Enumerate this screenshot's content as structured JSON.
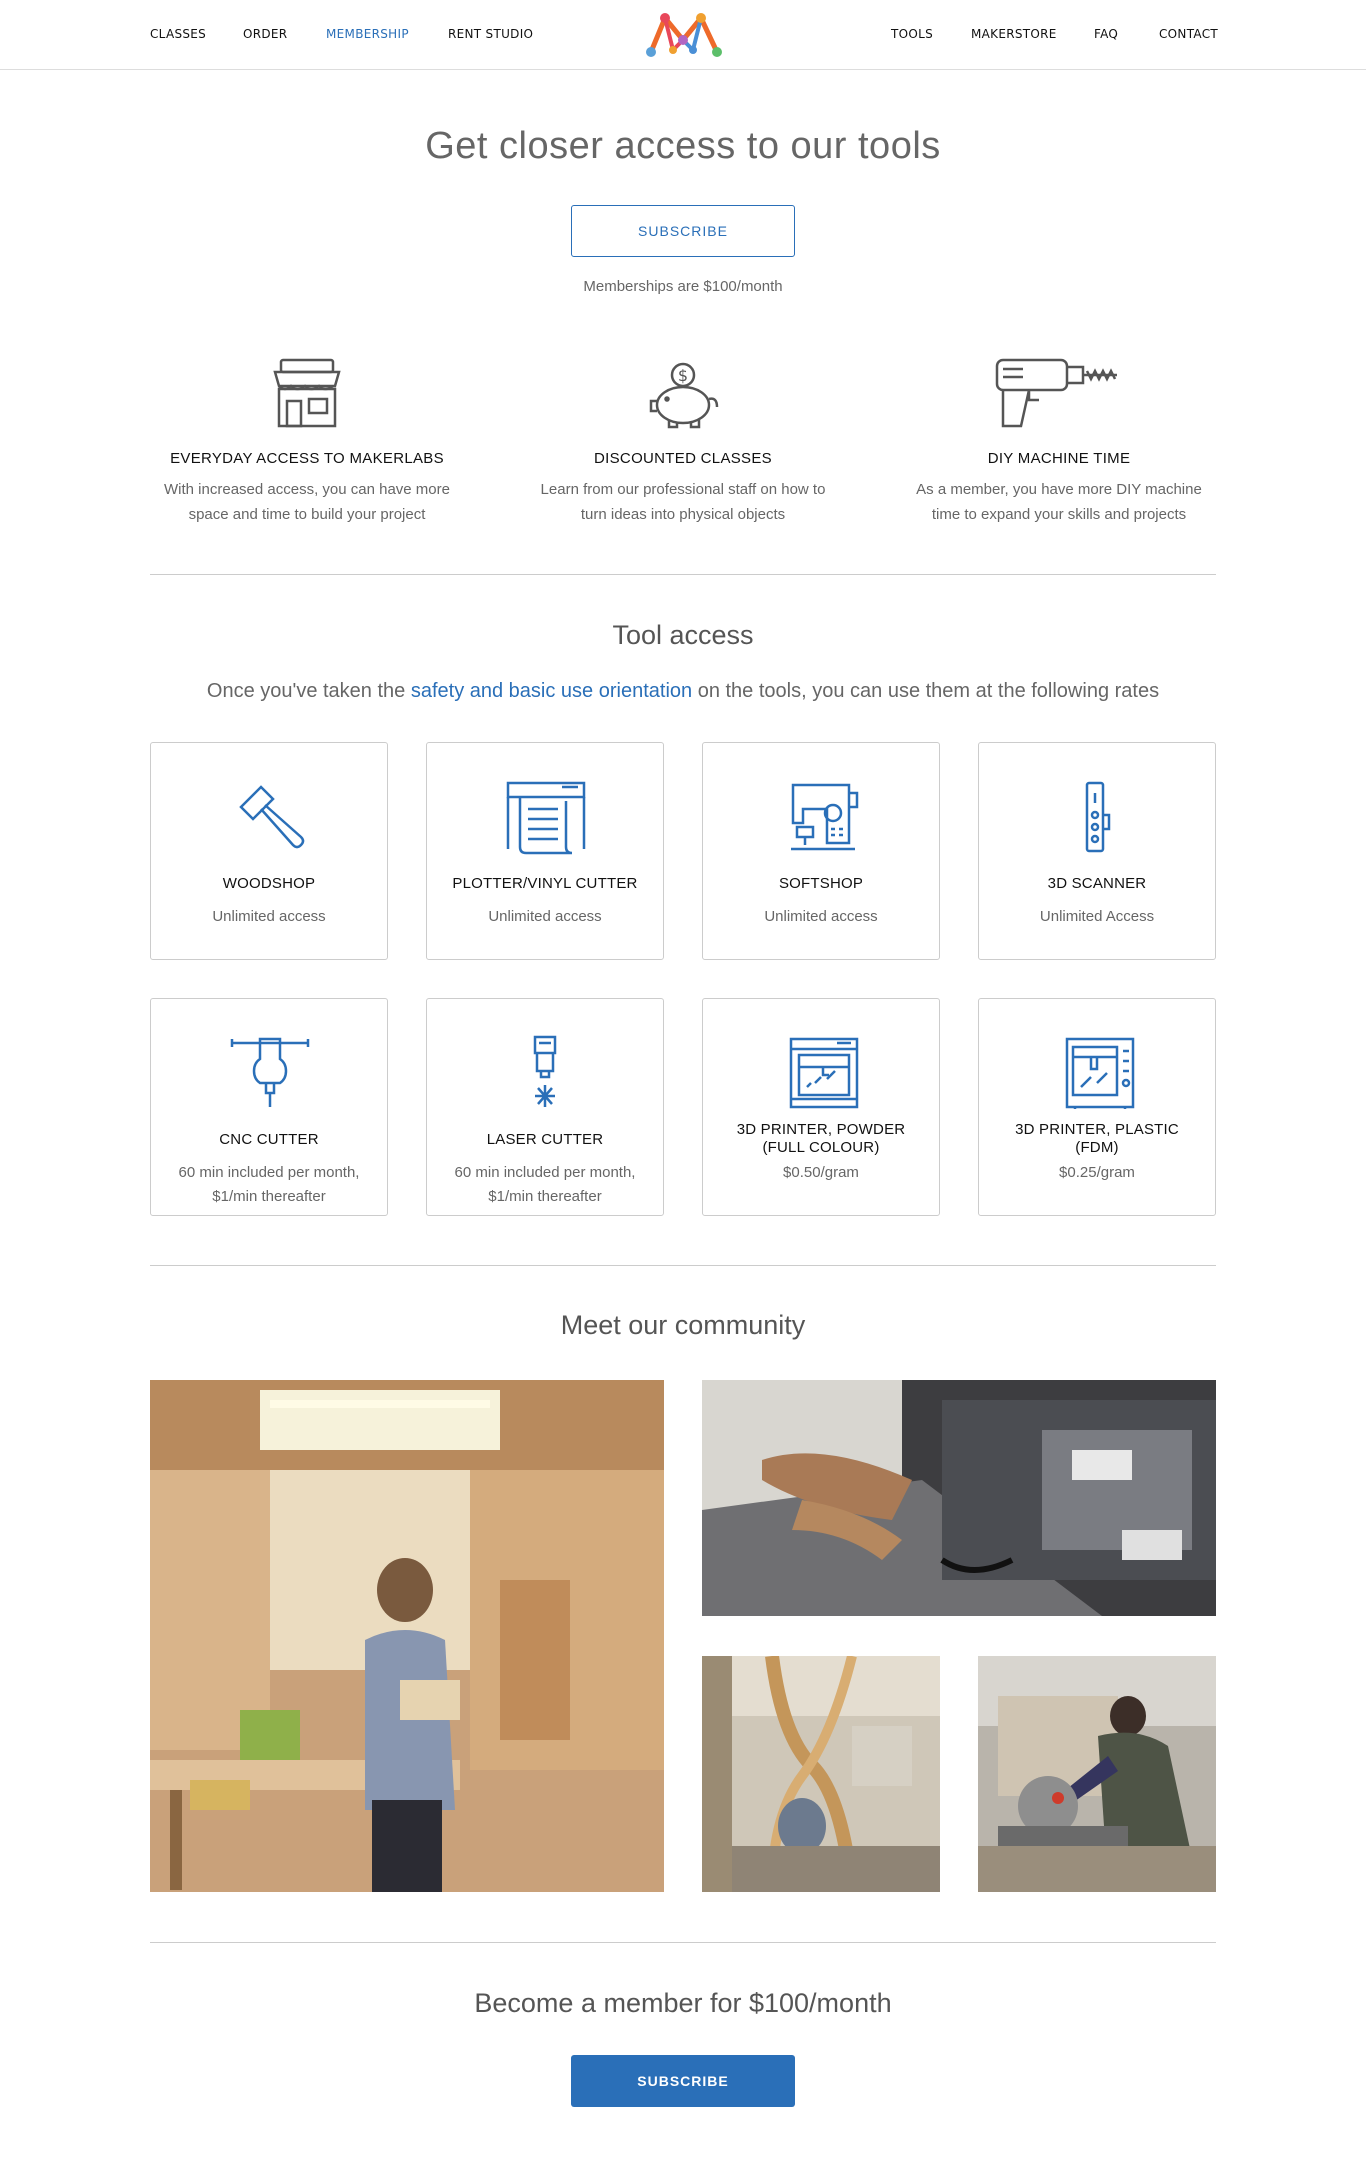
{
  "nav": {
    "left": [
      "CLASSES",
      "ORDER",
      "MEMBERSHIP",
      "RENT STUDIO"
    ],
    "right": [
      "TOOLS",
      "MAKERSTORE",
      "FAQ",
      "CONTACT"
    ],
    "active": "MEMBERSHIP"
  },
  "hero": {
    "title": "Get closer access to our tools",
    "subscribe_label": "SUBSCRIBE",
    "note": "Memberships are $100/month"
  },
  "features": [
    {
      "icon": "storefront-icon",
      "title": "EVERYDAY ACCESS TO MAKERLABS",
      "text1": "With increased access, you can have more",
      "text2": "space and time to build your project"
    },
    {
      "icon": "piggy-bank-icon",
      "title": "DISCOUNTED CLASSES",
      "text1": "Learn from our professional staff on how to",
      "text2": "turn ideas into physical objects"
    },
    {
      "icon": "drill-icon",
      "title": "DIY MACHINE TIME",
      "text1": "As a member, you have more DIY machine",
      "text2": "time to expand your skills and projects"
    }
  ],
  "tool_access": {
    "title": "Tool access",
    "intro_before": "Once you've taken the ",
    "intro_link": "safety and basic use orientation",
    "intro_after": " on the tools, you can use them at the following rates",
    "tools": [
      {
        "icon": "hammer-icon",
        "name": "WOODSHOP",
        "line1": "Unlimited access",
        "line2": ""
      },
      {
        "icon": "plotter-icon",
        "name": "PLOTTER/VINYL CUTTER",
        "line1": "Unlimited access",
        "line2": ""
      },
      {
        "icon": "sewing-machine-icon",
        "name": "SOFTSHOP",
        "line1": "Unlimited access",
        "line2": ""
      },
      {
        "icon": "scanner-icon",
        "name": "3D SCANNER",
        "line1": "Unlimited Access",
        "line2": ""
      },
      {
        "icon": "cnc-icon",
        "name": "CNC CUTTER",
        "line1": "60 min included per month,",
        "line2": "$1/min thereafter"
      },
      {
        "icon": "laser-icon",
        "name": "LASER CUTTER",
        "line1": "60 min included per month,",
        "line2": "$1/min thereafter"
      },
      {
        "icon": "powder-printer-icon",
        "name": "3D PRINTER, POWDER",
        "name2": "(FULL COLOUR)",
        "line1": "$0.50/gram",
        "line2": ""
      },
      {
        "icon": "fdm-printer-icon",
        "name": "3D PRINTER, PLASTIC",
        "name2": "(FDM)",
        "line1": "$0.25/gram",
        "line2": ""
      }
    ]
  },
  "community": {
    "title": "Meet our community"
  },
  "footer_cta": {
    "title": "Become a member for $100/month",
    "subscribe_label": "SUBSCRIBE"
  },
  "colors": {
    "accent": "#2a6fb8",
    "text": "#333333",
    "muted": "#666666",
    "border": "#cccccc"
  }
}
